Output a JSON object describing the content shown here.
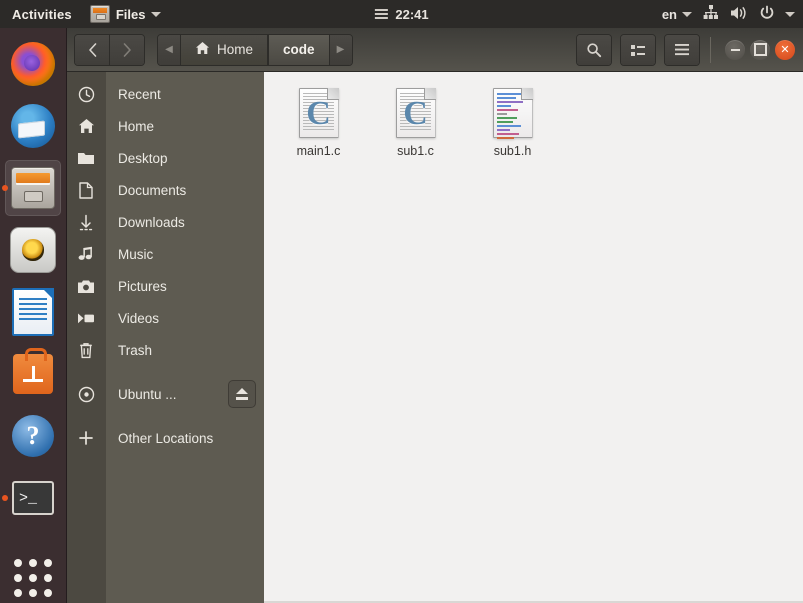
{
  "topbar": {
    "activities": "Activities",
    "app_name": "Files",
    "app_icon": "files-app-icon",
    "app_caret": "chevron-down-icon",
    "clock": "22:41",
    "clock_menu_icon": "hamburger-icon",
    "language": "en",
    "lang_caret": "chevron-down-icon",
    "network_icon": "network-wired-icon",
    "volume_icon": "volume-icon",
    "power_icon": "power-icon",
    "system_caret": "chevron-down-icon",
    "bg_color": "#2c2a28"
  },
  "dock": {
    "bg_color": "#3b2e30",
    "accent_color": "#e95420",
    "items": [
      {
        "name": "firefox",
        "label": "Firefox",
        "running": false,
        "active": false
      },
      {
        "name": "thunderbird",
        "label": "Thunderbird Mail",
        "running": false,
        "active": false
      },
      {
        "name": "files",
        "label": "Files",
        "running": true,
        "active": true
      },
      {
        "name": "rhythmbox",
        "label": "Rhythmbox",
        "running": false,
        "active": false
      },
      {
        "name": "libreoffice-writer",
        "label": "LibreOffice Writer",
        "running": false,
        "active": false
      },
      {
        "name": "ubuntu-software",
        "label": "Ubuntu Software",
        "running": false,
        "active": false
      },
      {
        "name": "help",
        "label": "Help",
        "running": false,
        "active": false
      },
      {
        "name": "terminal",
        "label": "Terminal",
        "running": true,
        "active": false
      }
    ],
    "show_apps_label": "Show Applications"
  },
  "window": {
    "headerbar": {
      "back_icon": "chevron-left-icon",
      "forward_icon": "chevron-right-icon",
      "path_prev_icon": "triangle-left-icon",
      "path_next_icon": "triangle-right-icon",
      "breadcrumbs": [
        {
          "label": "Home",
          "icon": "home-icon",
          "current": false
        },
        {
          "label": "code",
          "icon": "",
          "current": true
        }
      ],
      "search_icon": "search-icon",
      "view_toggle_icon": "list-view-icon",
      "menu_icon": "hamburger-menu-icon",
      "minimize_label": "Minimize",
      "maximize_label": "Maximize",
      "close_label": "Close"
    },
    "sidebar": {
      "bg_color": "#5e5b51",
      "icon_col_color": "#4c4941",
      "items": [
        {
          "label": "Recent",
          "icon": "clock-icon",
          "eject": false
        },
        {
          "label": "Home",
          "icon": "home-icon",
          "eject": false
        },
        {
          "label": "Desktop",
          "icon": "folder-icon",
          "eject": false
        },
        {
          "label": "Documents",
          "icon": "document-icon",
          "eject": false
        },
        {
          "label": "Downloads",
          "icon": "download-icon",
          "eject": false
        },
        {
          "label": "Music",
          "icon": "music-note-icon",
          "eject": false
        },
        {
          "label": "Pictures",
          "icon": "camera-icon",
          "eject": false
        },
        {
          "label": "Videos",
          "icon": "video-icon",
          "eject": false
        },
        {
          "label": "Trash",
          "icon": "trash-icon",
          "eject": false
        }
      ],
      "devices": [
        {
          "label": "Ubuntu ...",
          "icon": "disc-icon",
          "eject": true,
          "eject_icon": "eject-icon"
        }
      ],
      "other": [
        {
          "label": "Other Locations",
          "icon": "plus-icon",
          "eject": false
        }
      ]
    },
    "content": {
      "bg_color": "#f2f1f0",
      "files": [
        {
          "name": "main1.c",
          "icon": "c-source-file-icon",
          "type": "c-source"
        },
        {
          "name": "sub1.c",
          "icon": "c-source-file-icon",
          "type": "c-source"
        },
        {
          "name": "sub1.h",
          "icon": "c-header-file-icon",
          "type": "c-header"
        }
      ]
    }
  }
}
